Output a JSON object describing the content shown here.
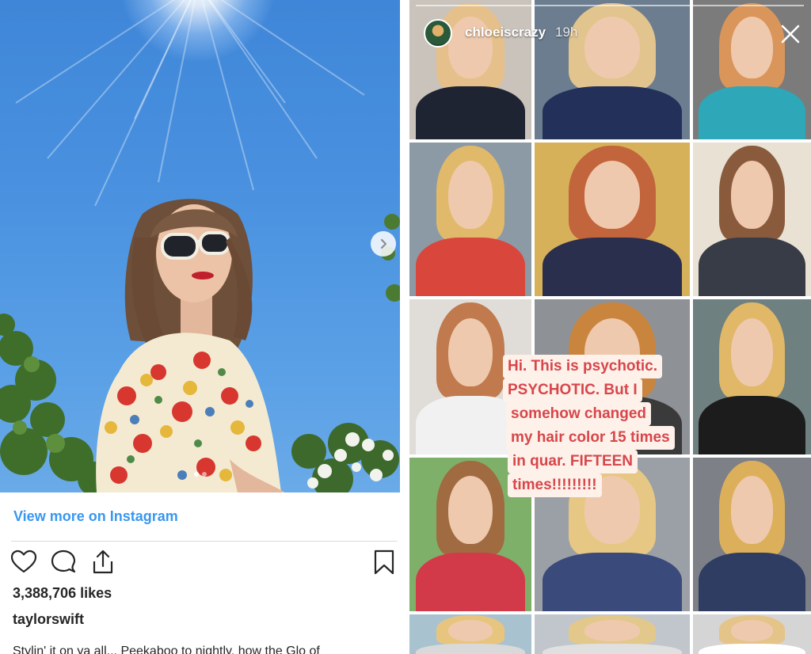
{
  "instagram_post": {
    "view_more": "View more on Instagram",
    "likes": "3,388,706 likes",
    "username": "taylorswift",
    "caption": "Stylin' it on ya all... Peekaboo to nightly, how the Glo of",
    "carousel": {
      "slide_count": 2,
      "active_slide": 1
    },
    "icons": [
      "heart-icon",
      "comment-icon",
      "share-icon",
      "bookmark-icon",
      "chevron-right-icon"
    ]
  },
  "story": {
    "username": "chloeiscrazy",
    "time": "19h",
    "close_icon": "close-icon",
    "text_lines": [
      "Hi. This is psychotic.",
      "PSYCHOTIC. But I",
      "somehow changed",
      "my hair color 15 times",
      "in quar. FIFTEEN",
      "times!!!!!!!!!"
    ],
    "text_color": "#d8464a",
    "text_bg": "#fdf1ea"
  },
  "colors": {
    "link": "#3897f0",
    "text": "#262626",
    "divider": "#dbdbdb"
  }
}
